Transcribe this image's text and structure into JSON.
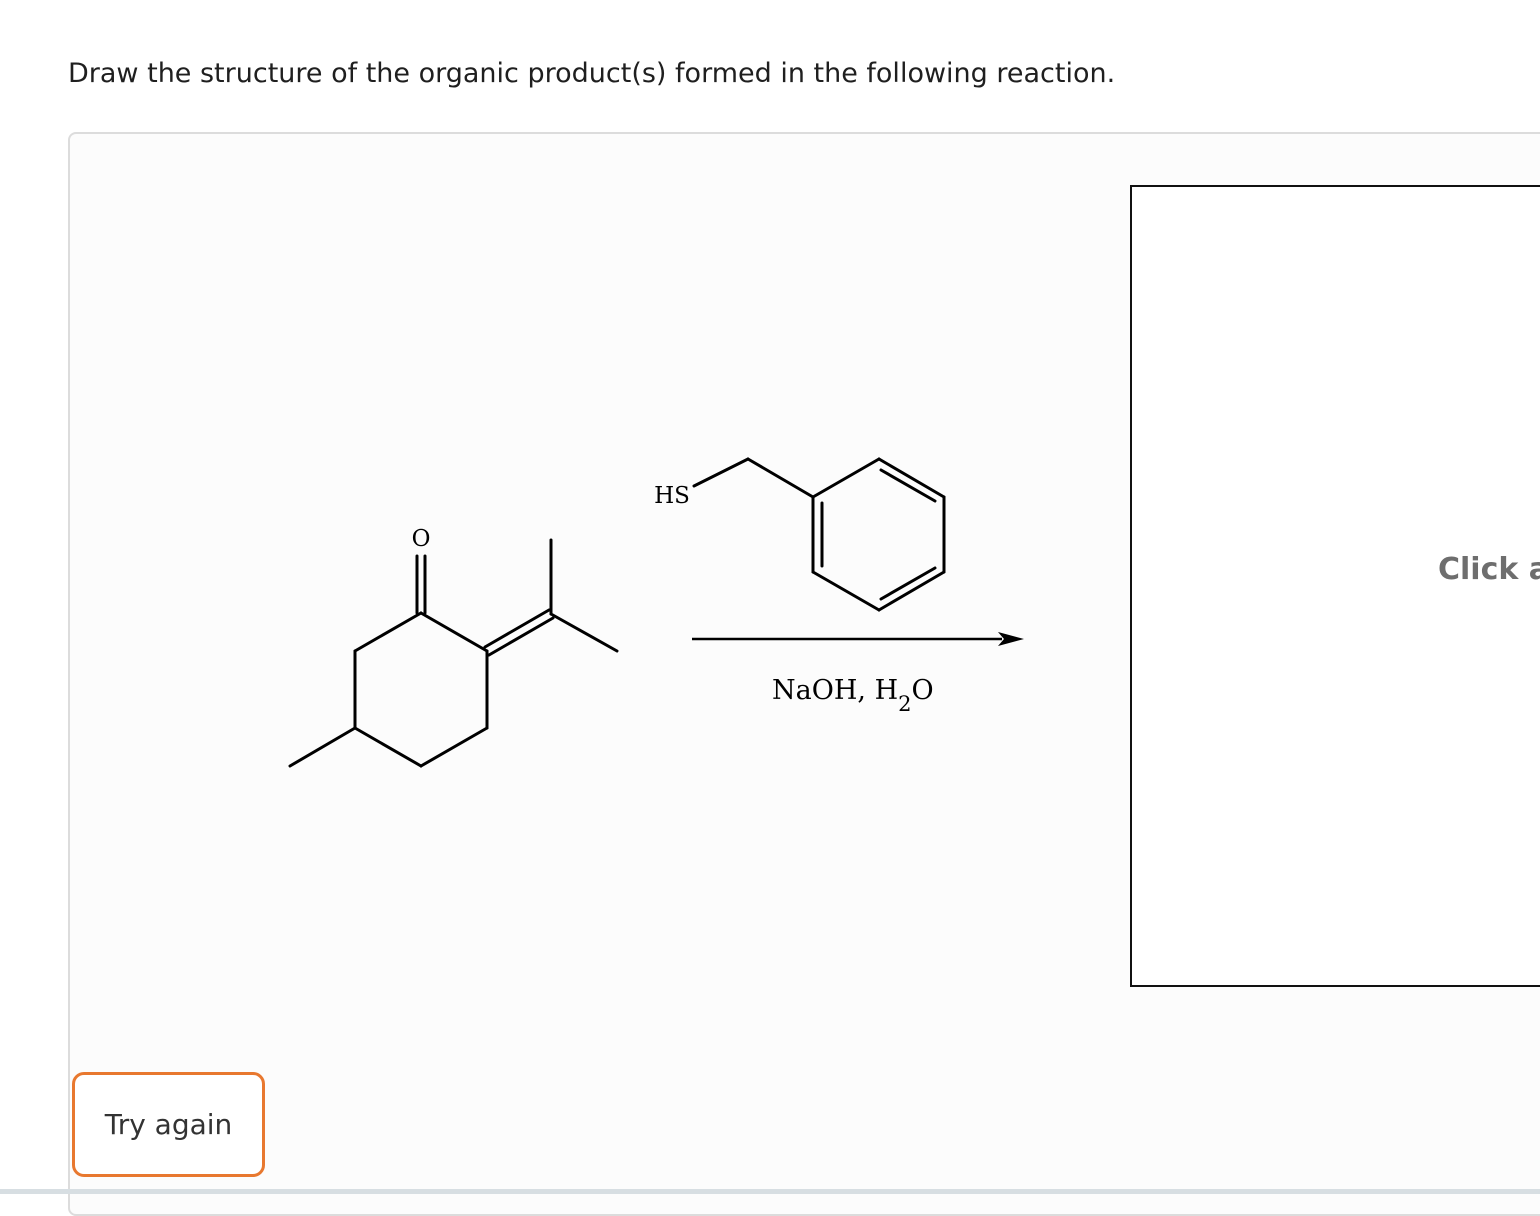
{
  "question": {
    "prompt": "Draw the structure of the organic product(s) formed in the following reaction."
  },
  "reaction": {
    "reactant1_atom_label": "O",
    "reactant2_atom_label": "HS",
    "reagent_main": "NaOH, H",
    "reagent_subscript": "2",
    "reagent_tail": "O"
  },
  "answer_area": {
    "hint": "Click a"
  },
  "feedback": {
    "try_again_label": "Try again",
    "border_color": "#e8782f"
  }
}
